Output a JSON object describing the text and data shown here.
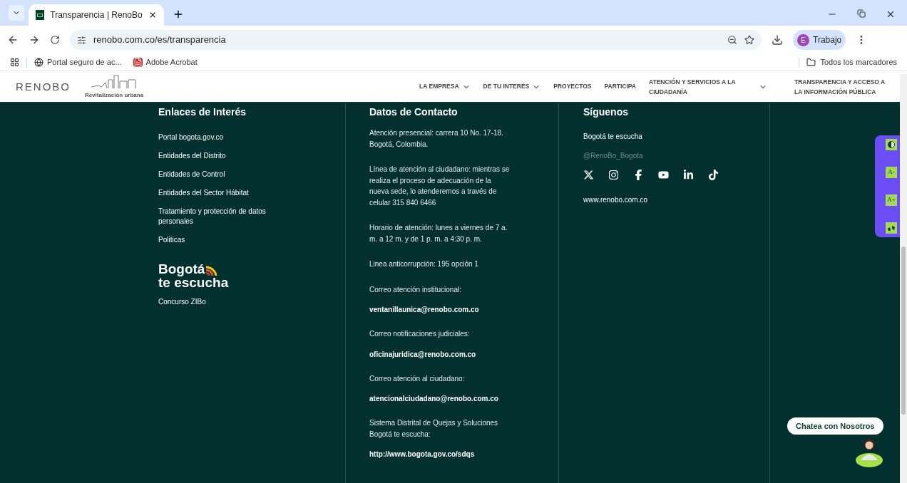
{
  "browser": {
    "tab": {
      "title": "Transparencia | RenoBo",
      "selected": true
    },
    "url": "renobo.com.co/es/transparencia",
    "profile": {
      "initial": "E",
      "label": "Trabajo"
    },
    "bookmarks": [
      {
        "label": "Portal seguro de ac...",
        "kind": "globe"
      },
      {
        "label": "Adobe Acrobat",
        "kind": "pdf"
      }
    ],
    "all_bookmarks": "Todos los marcadores"
  },
  "header": {
    "logo": "RENOBO",
    "logo_caption": "Revitalización urbana",
    "nav": [
      {
        "label": "LA EMPRESA",
        "has_menu": true
      },
      {
        "label": "DE TU INTERÉS",
        "has_menu": true
      },
      {
        "label": "PROYECTOS",
        "has_menu": false
      },
      {
        "label": "PARTICIPA",
        "has_menu": false
      },
      {
        "label": "ATENCIÓN Y SERVICIOS A LA CIUDADANÍA",
        "has_menu": true
      },
      {
        "label": "TRANSPARENCIA Y ACCESO A LA INFORMACIÓN PÚBLICA",
        "has_menu": false
      }
    ]
  },
  "footer": {
    "links": {
      "title": "Enlaces de Interés",
      "items": [
        "Portal bogota.gov.co",
        "Entidades del Distrito",
        "Entidades de Control",
        "Entidades del Sector Hábitat",
        "Tratamiento y protección de datos personales",
        "Politicas"
      ],
      "logo": [
        "Bogotá",
        "te escucha"
      ],
      "logo_link": "Concurso ZIBo"
    },
    "contact": {
      "title": "Datos de Contacto",
      "items": [
        {
          "text": "Atención presencial: carrera 10 No. 17-18. Bogotá, Colombia.",
          "kind": "text"
        },
        {
          "text": "Línea de atención al ciudadano: mientras se realiza el proceso de adecuación de la nueva sede, lo atenderemos a través de celular 315 840 6466",
          "kind": "text"
        },
        {
          "text": "Horario de atención: lunes a viernes de 7 a. m. a 12 m. y de 1 p. m. a 4:30 p. m.",
          "kind": "text"
        },
        {
          "text": "Linea anticorrupción: 195 opción 1",
          "kind": "text"
        },
        {
          "text": "Correo atención institucional:",
          "kind": "label"
        },
        {
          "text": "ventanillaunica@renobo.com.co",
          "kind": "link"
        },
        {
          "text": "Correo notificaciones judiciales:",
          "kind": "label"
        },
        {
          "text": "oficinajuridica@renobo.com.co",
          "kind": "link"
        },
        {
          "text": "Correo atención al ciudadano:",
          "kind": "label"
        },
        {
          "text": "atencionalciudadano@renobo.com.co",
          "kind": "link"
        },
        {
          "text": "Sistema Distrital de Quejas y Soluciones Bogotá te escucha:",
          "kind": "label"
        },
        {
          "text": "http://www.bogota.gov.co/sdqs",
          "kind": "link"
        }
      ]
    },
    "social": {
      "title": "Síguenos",
      "line": "Bogotá te escucha",
      "handle": "@RenoBo_Bogota",
      "networks": [
        {
          "kind": "x"
        },
        {
          "kind": "instagram"
        },
        {
          "kind": "facebook"
        },
        {
          "kind": "youtube"
        },
        {
          "kind": "linkedin"
        },
        {
          "kind": "tiktok"
        }
      ],
      "website": "www.renobo.com.co"
    }
  },
  "accessibility": [
    {
      "kind": "contrast"
    },
    {
      "kind": "text",
      "label": "A-"
    },
    {
      "kind": "text",
      "label": "A+"
    },
    {
      "kind": "sign"
    }
  ],
  "chat": {
    "label": "Chatea con Nosotros"
  }
}
